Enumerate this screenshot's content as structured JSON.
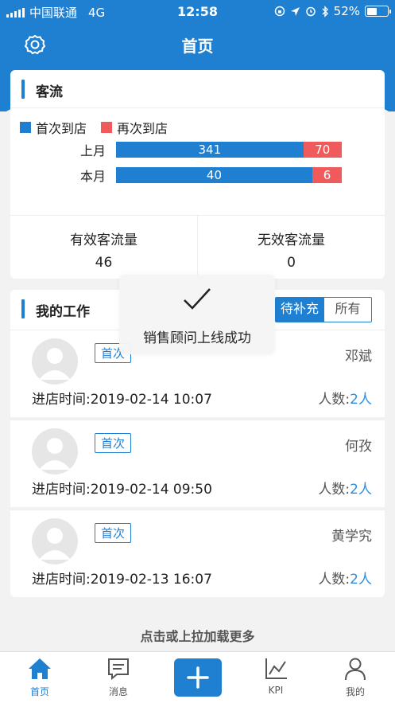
{
  "status_bar": {
    "carrier": "中国联通",
    "network": "4G",
    "time": "12:58",
    "battery": "52%",
    "battery_level": 0.52
  },
  "nav": {
    "title": "首页",
    "settings_icon": "gear-icon"
  },
  "traffic": {
    "title": "客流",
    "legend": [
      {
        "label": "首次到店",
        "color": "#1f7fd1"
      },
      {
        "label": "再次到店",
        "color": "#f05a5a"
      }
    ],
    "rows": [
      {
        "label": "上月",
        "first": 341,
        "repeat": 70
      },
      {
        "label": "本月",
        "first": 40,
        "repeat": 6
      }
    ],
    "stats": [
      {
        "label": "有效客流量",
        "value": "46"
      },
      {
        "label": "无效客流量",
        "value": "0"
      }
    ]
  },
  "work": {
    "title": "我的工作",
    "filters": {
      "pending": "待补充",
      "all": "所有"
    },
    "items": [
      {
        "badge": "首次",
        "name": "邓斌",
        "time": "进店时间:2019-02-14 10:07",
        "people_label": "人数:",
        "people_value": "2人"
      },
      {
        "badge": "首次",
        "name": "何孜",
        "time": "进店时间:2019-02-14 09:50",
        "people_label": "人数:",
        "people_value": "2人"
      },
      {
        "badge": "首次",
        "name": "黄学究",
        "time": "进店时间:2019-02-13 16:07",
        "people_label": "人数:",
        "people_value": "2人"
      }
    ]
  },
  "load_more": "点击或上拉加载更多",
  "toast": {
    "text": "销售顾问上线成功",
    "icon": "checkmark-icon"
  },
  "tabbar": {
    "tabs": [
      {
        "label": "首页",
        "icon": "home-icon"
      },
      {
        "label": "消息",
        "icon": "message-icon"
      },
      {
        "label": "",
        "icon": "plus-icon"
      },
      {
        "label": "KPI",
        "icon": "chart-icon"
      },
      {
        "label": "我的",
        "icon": "user-icon"
      }
    ]
  },
  "colors": {
    "primary": "#1f7fd1",
    "secondary": "#f05a5a"
  }
}
